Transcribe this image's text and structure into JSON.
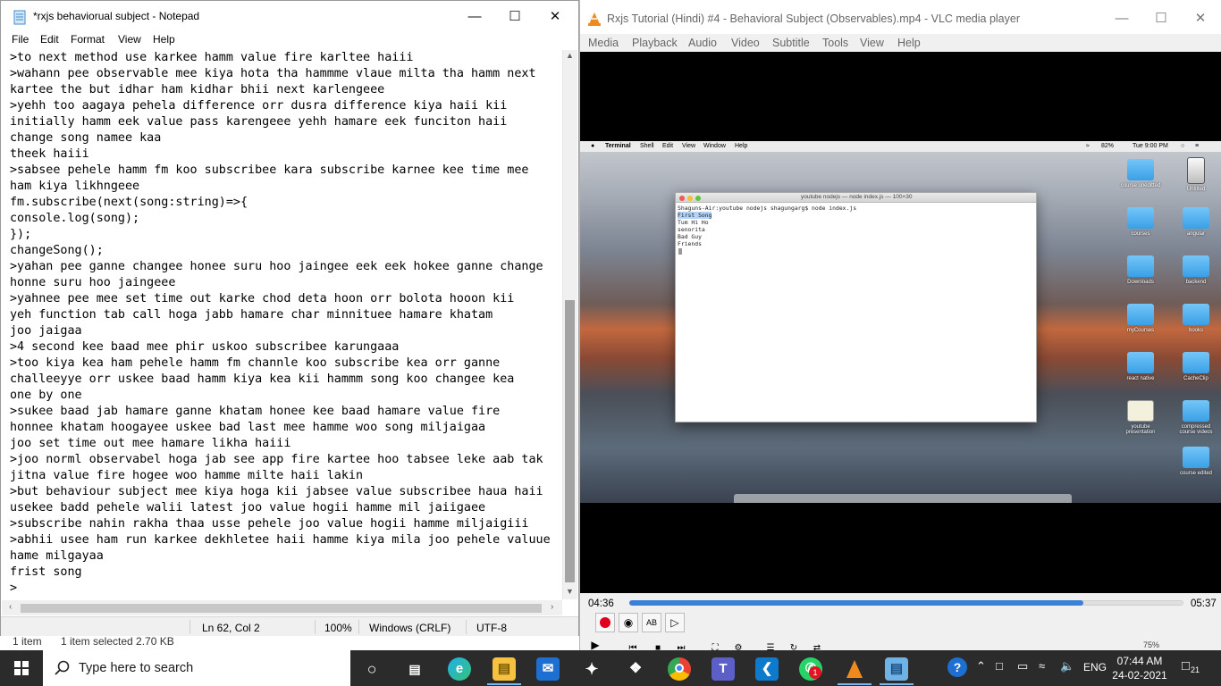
{
  "notepad": {
    "title": "*rxjs behaviorual subject - Notepad",
    "menu": [
      "File",
      "Edit",
      "Format",
      "View",
      "Help"
    ],
    "text": ">to next method use karkee hamm value fire karltee haiii\n>wahann pee observable mee kiya hota tha hammme vlaue milta tha hamm next\nkartee the but idhar ham kidhar bhii next karlengeee\n>yehh too aagaya pehela difference orr dusra difference kiya haii kii\ninitially hamm eek value pass karengeee yehh hamare eek funciton haii\nchange song namee kaa\ntheek haiii\n>sabsee pehele hamm fm koo subscribee kara subscribe karnee kee time mee\nham kiya likhngeee\nfm.subscribe(next(song:string)=>{\nconsole.log(song);\n});\nchangeSong();\n>yahan pee ganne changee honee suru hoo jaingee eek eek hokee ganne change\nhonne suru hoo jaingeee\n>yahnee pee mee set time out karke chod deta hoon orr bolota hooon kii\nyeh function tab call hoga jabb hamare char minnituee hamare khatam\njoo jaigaa\n>4 second kee baad mee phir uskoo subscribee karungaaa\n>too kiya kea ham pehele hamm fm channle koo subscribe kea orr ganne\nchalleeyye orr uskee baad hamm kiya kea kii hammm song koo changee kea\none by one\n>sukee baad jab hamare ganne khatam honee kee baad hamare value fire\nhonnee khatam hoogayee uskee bad last mee hamme woo song miljaigaa\njoo set time out mee hamare likha haiii\n>joo norml observabel hoga jab see app fire kartee hoo tabsee leke aab tak\njitna value fire hogee woo hamme milte haii lakin\n>but behaviour subject mee kiya hoga kii jabsee value subscribee haua haii\nusekee badd pehele walii latest joo value hogii hamme mil jaiigaee\n>subscribe nahin rakha thaa usse pehele joo value hogii hamme miljaigiii\n>abhii usee ham run karkee dekhletee haii hamme kiya mila joo pehele valuue\nhame milgayaa\nfrist song\n>",
    "status": {
      "position": "Ln 62, Col 2",
      "zoom": "100%",
      "line_endings": "Windows (CRLF)",
      "encoding": "UTF-8"
    },
    "vertical_scroll_fraction": 0.62
  },
  "explorer": {
    "items": "1 item",
    "selected": "1 item selected  2.70 KB"
  },
  "vlc": {
    "title": "Rxjs Tutorial (Hindi) #4 -  Behavioral Subject (Observables).mp4 - VLC media player",
    "menu": [
      "Media",
      "Playback",
      "Audio",
      "Video",
      "Subtitle",
      "Tools",
      "View",
      "Help"
    ],
    "elapsed": "04:36",
    "total": "05:37",
    "progress": 0.82,
    "volume": "75%"
  },
  "mac": {
    "menubar": [
      "Terminal",
      "Shell",
      "Edit",
      "View",
      "Window",
      "Help"
    ],
    "battery": "82%",
    "clock": "Tue 9:00 PM",
    "terminal_title": "youtube nodejs — node index.js — 100×30",
    "terminal_prompt": "Shaguns-Air:youtube nodejs shagungarg$ node index.js",
    "terminal_selected": "First Song",
    "terminal_lines": [
      "Tum Hi Ho",
      "senorita",
      "Bad Guy",
      "Friends"
    ],
    "desktop_icons": [
      "course uneditted",
      "Untitled",
      "courses",
      "angular",
      "Downloads",
      "backend",
      "myCourses",
      "books",
      "react native",
      "CacheClip",
      "youtube presentation",
      "compressed course videos",
      "course edited"
    ]
  },
  "taskbar": {
    "search_placeholder": "Type here to search",
    "language": "ENG",
    "time": "07:44 AM",
    "date": "24-02-2021",
    "notifications": "21",
    "teams_badge": "1"
  }
}
